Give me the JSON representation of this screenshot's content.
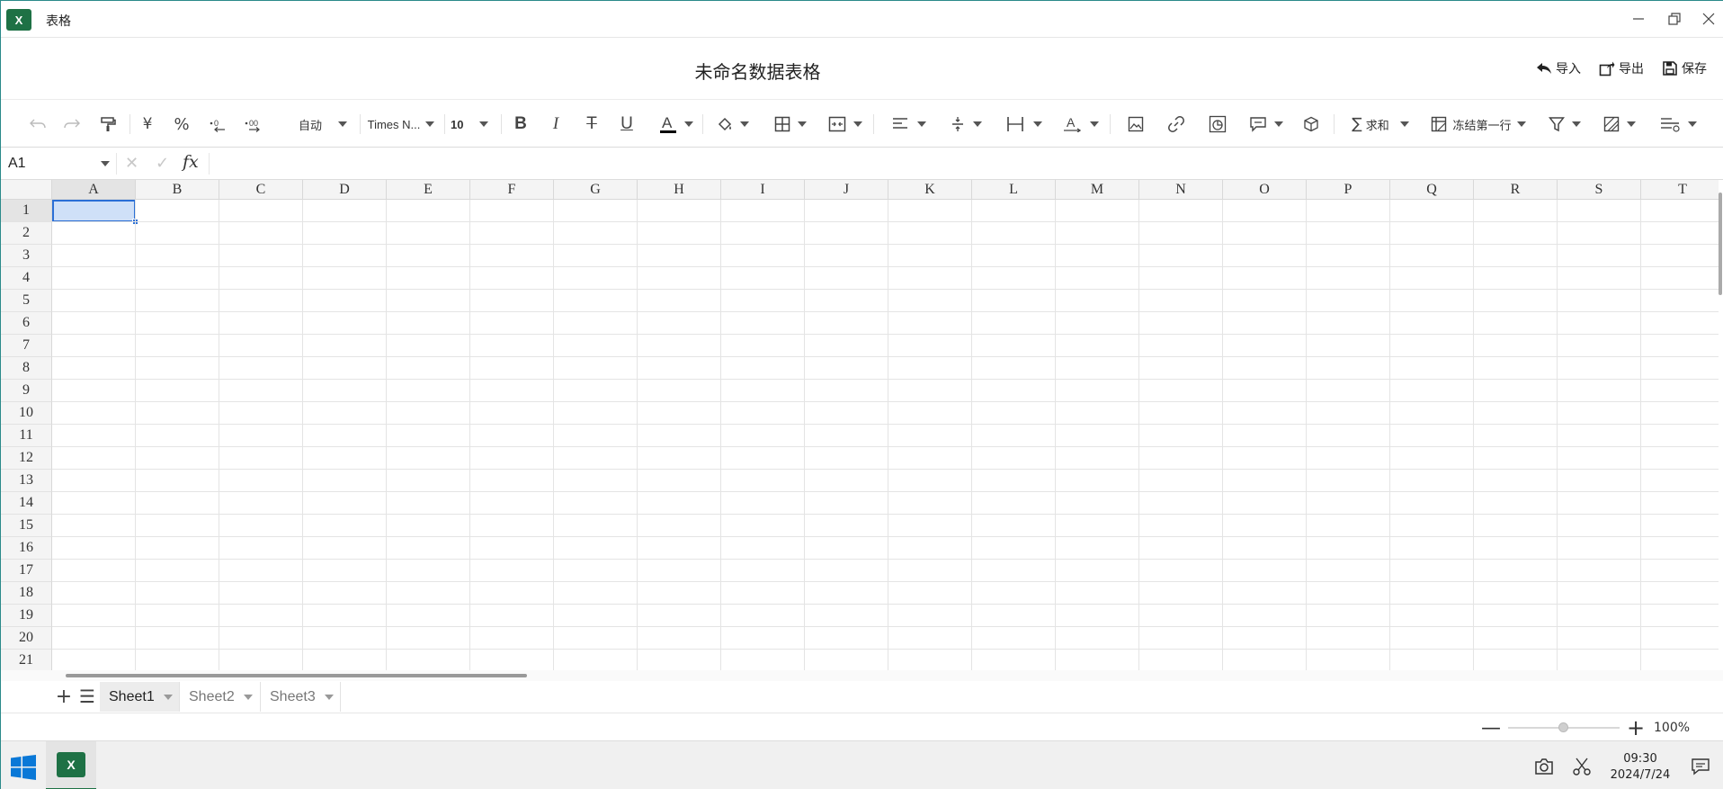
{
  "window": {
    "title": "表格",
    "app_badge": "X"
  },
  "document": {
    "title": "未命名数据表格",
    "actions": [
      {
        "label": "导入",
        "icon": "import-icon"
      },
      {
        "label": "导出",
        "icon": "export-icon"
      },
      {
        "label": "保存",
        "icon": "save-icon"
      }
    ]
  },
  "toolbar": {
    "currency_symbol": "¥",
    "percent_symbol": "%",
    "format_label": "自动",
    "font_name": "Times N...",
    "font_size": "10",
    "sum_label": "求和",
    "freeze_label": "冻结第一行"
  },
  "formula_bar": {
    "cell_ref": "A1",
    "fx_label": "fx",
    "value": ""
  },
  "grid": {
    "columns": [
      "A",
      "B",
      "C",
      "D",
      "E",
      "F",
      "G",
      "H",
      "I",
      "J",
      "K",
      "L",
      "M",
      "N",
      "O",
      "P",
      "Q",
      "R",
      "S",
      "T"
    ],
    "rows": [
      "1",
      "2",
      "3",
      "4",
      "5",
      "6",
      "7",
      "8",
      "9",
      "10",
      "11",
      "12",
      "13",
      "14",
      "15",
      "16",
      "17",
      "18",
      "19",
      "20",
      "21"
    ],
    "selected_cell": "A1"
  },
  "sheets": [
    {
      "name": "Sheet1",
      "active": true
    },
    {
      "name": "Sheet2",
      "active": false
    },
    {
      "name": "Sheet3",
      "active": false
    }
  ],
  "status": {
    "zoom": "100%",
    "zoom_fraction": 0.5
  },
  "taskbar": {
    "time": "09:30",
    "date": "2024/7/24"
  },
  "colors": {
    "accent": "#1e7145",
    "selection": "#2b6fd6",
    "selection_fill": "#cfe0f8"
  }
}
